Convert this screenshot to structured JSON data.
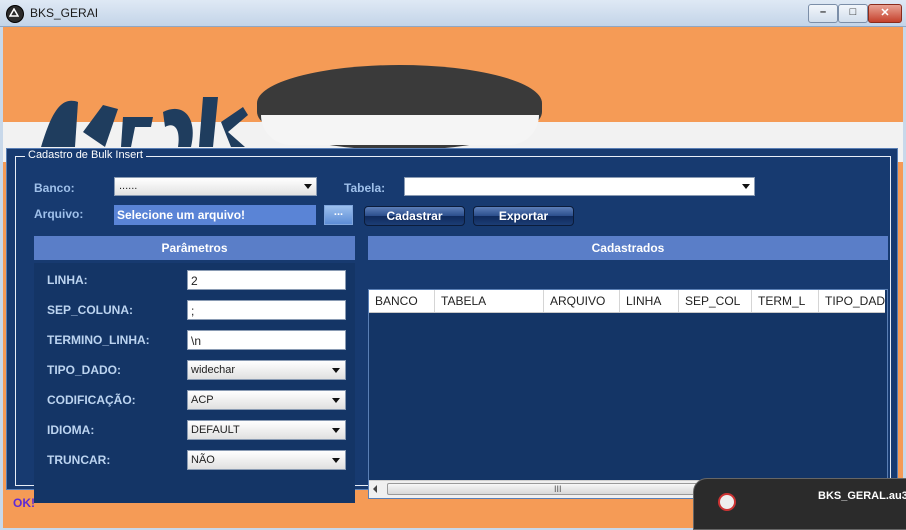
{
  "window": {
    "title": "BKS_GERAI",
    "buttons": {
      "minimize": "–",
      "maximize": "□",
      "close": "✕"
    }
  },
  "group": {
    "title": "Cadastro de Bulk Insert"
  },
  "form": {
    "banco_label": "Banco:",
    "banco_value": "......",
    "tabela_label": "Tabela:",
    "tabela_value": "",
    "arquivo_label": "Arquivo:",
    "arquivo_value": "Selecione um arquivo!",
    "browse_label": "...",
    "cadastrar_label": "Cadastrar",
    "exportar_label": "Exportar"
  },
  "params": {
    "title": "Parâmetros",
    "fields": [
      {
        "label": "LINHA:",
        "value": "2",
        "kind": "input"
      },
      {
        "label": "SEP_COLUNA:",
        "value": ";",
        "kind": "input"
      },
      {
        "label": "TERMINO_LINHA:",
        "value": "\\n",
        "kind": "input"
      },
      {
        "label": "TIPO_DADO:",
        "value": "widechar",
        "kind": "select"
      },
      {
        "label": "CODIFICAÇÃO:",
        "value": "ACP",
        "kind": "select"
      },
      {
        "label": "IDIOMA:",
        "value": "DEFAULT",
        "kind": "select"
      },
      {
        "label": "TRUNCAR:",
        "value": "NÃO",
        "kind": "select"
      }
    ]
  },
  "cadastrados": {
    "title": "Cadastrados",
    "columns": [
      "BANCO",
      "TABELA",
      "ARQUIVO",
      "LINHA",
      "SEP_COL",
      "TERM_L",
      "TIPO_DADO"
    ],
    "scroll_grip": "III"
  },
  "status": {
    "text": "OK!"
  },
  "taskbar": {
    "label": "BKS_GERAL.au3"
  },
  "colors": {
    "background_orange": "#f59b56",
    "panel_blue": "#173a70",
    "section_header": "#5a7ec8",
    "label_text": "#9fc0ea",
    "status_text": "#5d2bd6"
  }
}
